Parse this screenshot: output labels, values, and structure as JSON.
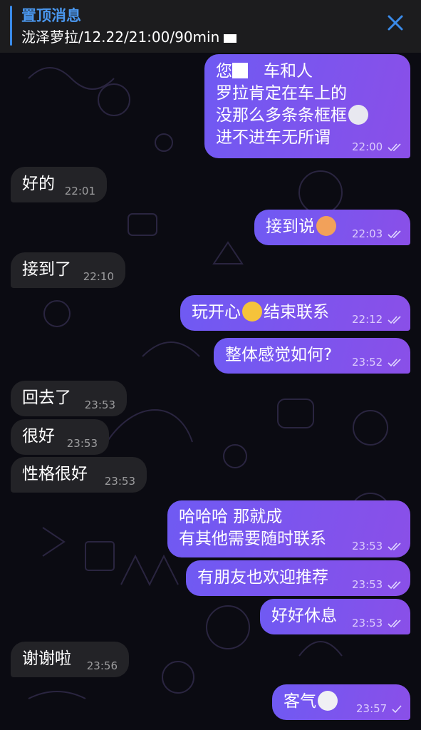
{
  "pinned": {
    "title": "置顶消息",
    "text": "泷泽萝拉/12.22/21:00/90min"
  },
  "messages": [
    {
      "dir": "out",
      "lines": [
        "您",
        "车和人",
        "罗拉肯定在车上的",
        "没那么多条条框框",
        "进不进车无所谓"
      ],
      "time": "22:00",
      "ticks": "double"
    },
    {
      "dir": "in",
      "text": "好的",
      "time": "22:01"
    },
    {
      "dir": "out",
      "text": "接到说",
      "time": "22:03",
      "ticks": "double",
      "emoji": "cat-face-emoji"
    },
    {
      "dir": "in",
      "text": "接到了",
      "time": "22:10"
    },
    {
      "dir": "out",
      "text_a": "玩开心",
      "text_b": "结束联系",
      "time": "22:12",
      "ticks": "double",
      "emoji": "party-face-emoji"
    },
    {
      "dir": "out",
      "text": "整体感觉如何?",
      "time": "23:52",
      "ticks": "double"
    },
    {
      "dir": "in",
      "text": "回去了",
      "time": "23:53"
    },
    {
      "dir": "in",
      "text": "很好",
      "time": "23:53"
    },
    {
      "dir": "in",
      "text": "性格很好",
      "time": "23:53"
    },
    {
      "dir": "out",
      "lines": [
        "哈哈哈 那就成",
        "有其他需要随时联系"
      ],
      "time": "23:53",
      "ticks": "double"
    },
    {
      "dir": "out",
      "text": "有朋友也欢迎推荐",
      "time": "23:53",
      "ticks": "double"
    },
    {
      "dir": "out",
      "text": "好好休息",
      "time": "23:53",
      "ticks": "double"
    },
    {
      "dir": "in",
      "text": "谢谢啦",
      "time": "23:56"
    },
    {
      "dir": "out",
      "text": "客气",
      "time": "23:57",
      "ticks": "single",
      "emoji": "grin-face-emoji"
    }
  ],
  "colors": {
    "outgoing_bubble": "#7b55ee",
    "incoming_bubble": "#232327",
    "pinned_accent": "#3a8ae8"
  },
  "icons": [
    "close-icon",
    "double-check-icon",
    "single-check-icon"
  ]
}
